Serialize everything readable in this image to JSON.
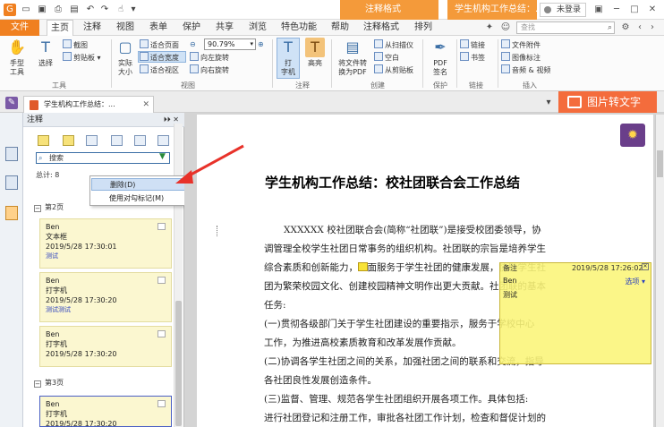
{
  "titlebar": {
    "context_tab": "注释格式",
    "doc_title": "学生机构工作总结：...",
    "login": "未登录"
  },
  "tabs": {
    "file": "文件",
    "items": [
      "主页",
      "注释",
      "视图",
      "表单",
      "保护",
      "共享",
      "浏览",
      "特色功能",
      "帮助",
      "注释格式",
      "排列"
    ],
    "search_placeholder": "查找"
  },
  "ribbon": {
    "hand": "手型\n工具",
    "select": "选择",
    "screenshot": "截图",
    "clipboard": "剪贴板",
    "tools_group": "工具",
    "actual_size": "实际\n大小",
    "fit_page": "适合页面",
    "fit_width": "适合宽度",
    "fit_view": "适合视区",
    "zoom": "90.79%",
    "rotate_left": "向左旋转",
    "rotate_right": "向右旋转",
    "view_group": "视图",
    "typewriter": "打\n字机",
    "highlight": "高亮",
    "comment_group": "注释",
    "convert_pdf": "将文件转\n换为PDF",
    "from_scanner": "从扫描仪",
    "blank": "空白",
    "from_clipboard": "从剪贴板",
    "create_group": "创建",
    "pdf_sign": "PDF\n签名",
    "protect_group": "保护",
    "link": "链接",
    "bookmark": "书签",
    "link_group": "链接",
    "file_attach": "文件附件",
    "image_anno": "图像标注",
    "audio_video": "音频 & 视频",
    "insert_group": "插入"
  },
  "doctab": {
    "title": "学生机构工作总结：...",
    "img_to_text": "图片转文字"
  },
  "panel": {
    "title": "注释",
    "search_placeholder": "搜索",
    "total": "总计: 8",
    "context_menu": [
      "删除(D)",
      "使用对勾标记(M)"
    ],
    "groups": [
      {
        "label": "第2页",
        "cards": [
          {
            "author": "Ben",
            "type": "文本框",
            "date": "2019/5/28 17:30:01",
            "note": "测试"
          },
          {
            "author": "Ben",
            "type": "打字机",
            "date": "2019/5/28 17:30:20",
            "note": "测试测试"
          },
          {
            "author": "Ben",
            "type": "打字机",
            "date": "2019/5/28 17:30:20",
            "note": "测试测试"
          }
        ]
      },
      {
        "label": "第3页",
        "cards": [
          {
            "author": "Ben",
            "type": "打字机",
            "date": "2019/5/28 17:30:20",
            "note": ""
          }
        ]
      }
    ]
  },
  "document": {
    "heading": "学生机构工作总结：校社团联合会工作总结",
    "lines": [
      "XXXXXX 校社团联合会(简称“社团联”)是接受校团委领导，协",
      "调管理全校学生社团日常事务的组织机构。社团联的宗旨是培养学生",
      "综合素质和创新能力，全面服务于学生社团的健康发展，协助学生社",
      "团为繁荣校园文化、创建校园精神文明作出更大贡献。社团联的基本",
      "任务:",
      "(一)贯彻各级部门关于学生社团建设的重要指示，服务于学校中心",
      "工作，为推进高校素质教育和改革发展作贡献。",
      "(二)协调各学生社团之间的关系，加强社团之间的联系和交流，指导",
      "各社团良性发展创造条件。",
      "(三)监督、管理、规范各学生社团组织开展各项工作。具体包括:",
      "进行社团登记和注册工作，审批各社团工作计划，检查和督促计划的"
    ]
  },
  "popup": {
    "label": "备注",
    "date": "2019/5/28 17:26:02",
    "author": "Ben",
    "options": "选项",
    "body": "测试"
  },
  "colors": {
    "accent_orange": "#f08020",
    "img_to_text": "#f46c3c",
    "note_yellow": "#fbf7d0",
    "arrow_red": "#e8322a"
  }
}
